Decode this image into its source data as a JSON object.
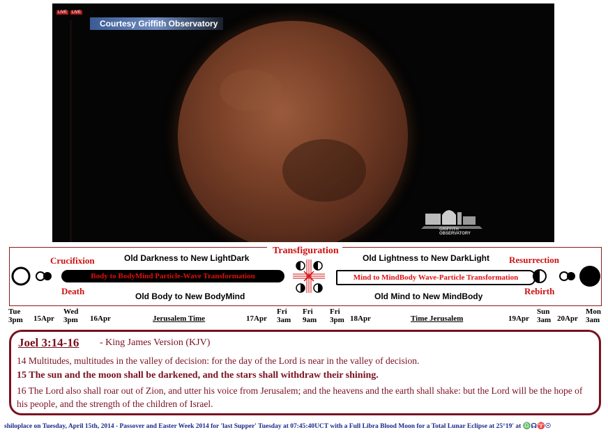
{
  "video": {
    "courtesy": "Courtesy Griffith Observatory",
    "live_badges": [
      "LIVE",
      "LIVE"
    ],
    "watermark": "GRIFFITH OBSERVATORY"
  },
  "diagram": {
    "crucifixion": "Crucifixion",
    "death": "Death",
    "transfiguration": "Transfiguration",
    "resurrection": "Resurrection",
    "rebirth": "Rebirth",
    "old_darkness": "Old Darkness to New LightDark",
    "old_body": "Old Body to New BodyMind",
    "old_lightness": "Old Lightness to New DarkLight",
    "old_mind": "Old Mind to New MindBody",
    "body_transform": "Body to BodyMind Particle-Wave Transformation",
    "mind_transform": "Mind to MindBody Wave-Particle Transformation"
  },
  "timeline": {
    "tue": [
      "Tue",
      "3pm"
    ],
    "apr15": "15Apr",
    "wed": [
      "Wed",
      "3pm"
    ],
    "apr16": "16Apr",
    "jerusalem_time": "Jerusalem Time",
    "apr17": "17Apr",
    "fri1": [
      "Fri",
      "3am"
    ],
    "fri2": [
      "Fri",
      "9am"
    ],
    "fri3": [
      "Fri",
      "3pm"
    ],
    "apr18": "18Apr",
    "time_jerusalem": "Time Jerusalem",
    "apr19": "19Apr",
    "sun": [
      "Sun",
      "3am"
    ],
    "apr20": "20Apr",
    "mon": [
      "Mon",
      "3am"
    ]
  },
  "scripture": {
    "reference": "Joel 3:14-16",
    "version": "- King James Version (KJV)",
    "v14": "14 Multitudes, multitudes in the valley of decision: for the day of the Lord is near in the valley of decision.",
    "v15": "15 The sun and the moon shall be darkened, and the stars shall withdraw their shining.",
    "v16": "16 The Lord also shall roar out of Zion, and utter his voice from Jerusalem; and the heavens and the earth shall shake: but the Lord will be the hope of his people, and the strength of the children of Israel."
  },
  "footer": "shiloplace on Tuesday, April 15th, 2014 - Passover and Easter Week 2014 for 'last Supper' Tuesday at 07:45:40UCT with a Full Libra Blood Moon for a Total Lunar Eclipse at 25°19' at ♎☊♈☉"
}
